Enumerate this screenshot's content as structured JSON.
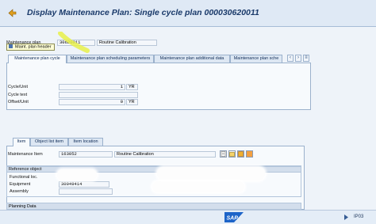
{
  "title": "Display Maintenance Plan: Single cycle plan 000030620011",
  "header": {
    "maintenance_plan_label": "Maintenance plan",
    "maintenance_plan_value": "30620011",
    "maintenance_plan_text": "Routine Calibration",
    "tooltip": "Maint. plan header"
  },
  "top_tabs": [
    {
      "label": "Maintenance plan cycle",
      "active": true
    },
    {
      "label": "Maintenance plan scheduling parameters",
      "active": false
    },
    {
      "label": "Maintenance plan additional data",
      "active": false
    },
    {
      "label": "Maintenance plan sche",
      "active": false
    }
  ],
  "cycle": {
    "cycle_unit_label": "Cycle/Unit",
    "cycle_value": "1",
    "cycle_unit": "YR",
    "cycle_text_label": "Cycle text",
    "cycle_text_value": "",
    "offset_unit_label": "Offset/Unit",
    "offset_value": "0",
    "offset_unit": "YR"
  },
  "item_tabs": [
    {
      "label": "Item",
      "active": true
    },
    {
      "label": "Object list item",
      "active": false
    },
    {
      "label": "Item location",
      "active": false
    }
  ],
  "item": {
    "maintenance_item_label": "Maintenance Item",
    "maintenance_item_value": "163052",
    "maintenance_item_text": "Routine Calibration"
  },
  "reference_object": {
    "title": "Reference object",
    "functional_loc_label": "Functional loc.",
    "equipment_label": "Equipment",
    "equipment_value": "30049414",
    "assembly_label": "Assembly"
  },
  "planning_data": {
    "title": "Planning Data"
  },
  "status": {
    "logo": "SAP",
    "system_id": "IP03"
  },
  "colors": {
    "title": "#1a3a6a",
    "highlight": "#e8f04a",
    "background": "#eef3f9",
    "tab_active": "#f7fafd",
    "sap_blue": "#1d64c8"
  }
}
